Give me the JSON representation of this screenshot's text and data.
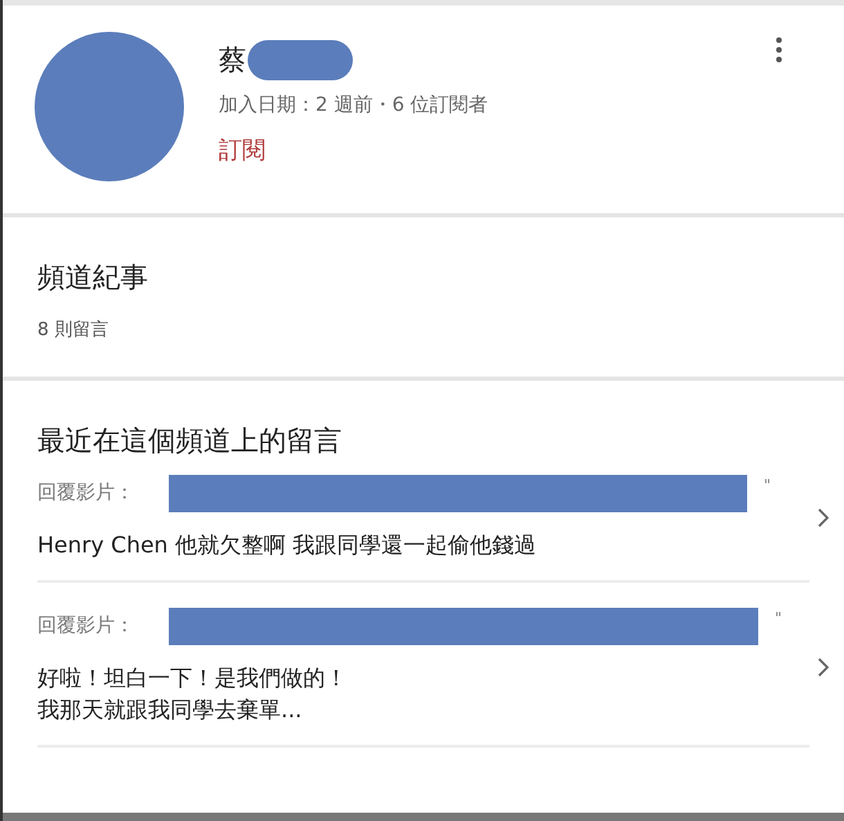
{
  "channel": {
    "name": "蔡",
    "joined": "加入日期：2 週前・6 位訂閱者",
    "subscribe_button": "訂閱"
  },
  "about": {
    "title": "頻道紀事",
    "comment_count": "8 則留言"
  },
  "recent_comments": {
    "title": "最近在這個頻道上的留言",
    "items": [
      {
        "reply_label": "回覆影片：",
        "quote_mark": "\"",
        "lines": [
          "Henry Chen 他就欠整啊 我跟同學還一起偷他錢過"
        ]
      },
      {
        "reply_label": "回覆影片：",
        "quote_mark": "\"",
        "lines": [
          "好啦！坦白一下！是我們做的！",
          "我那天就跟我同學去棄單..."
        ]
      }
    ]
  }
}
